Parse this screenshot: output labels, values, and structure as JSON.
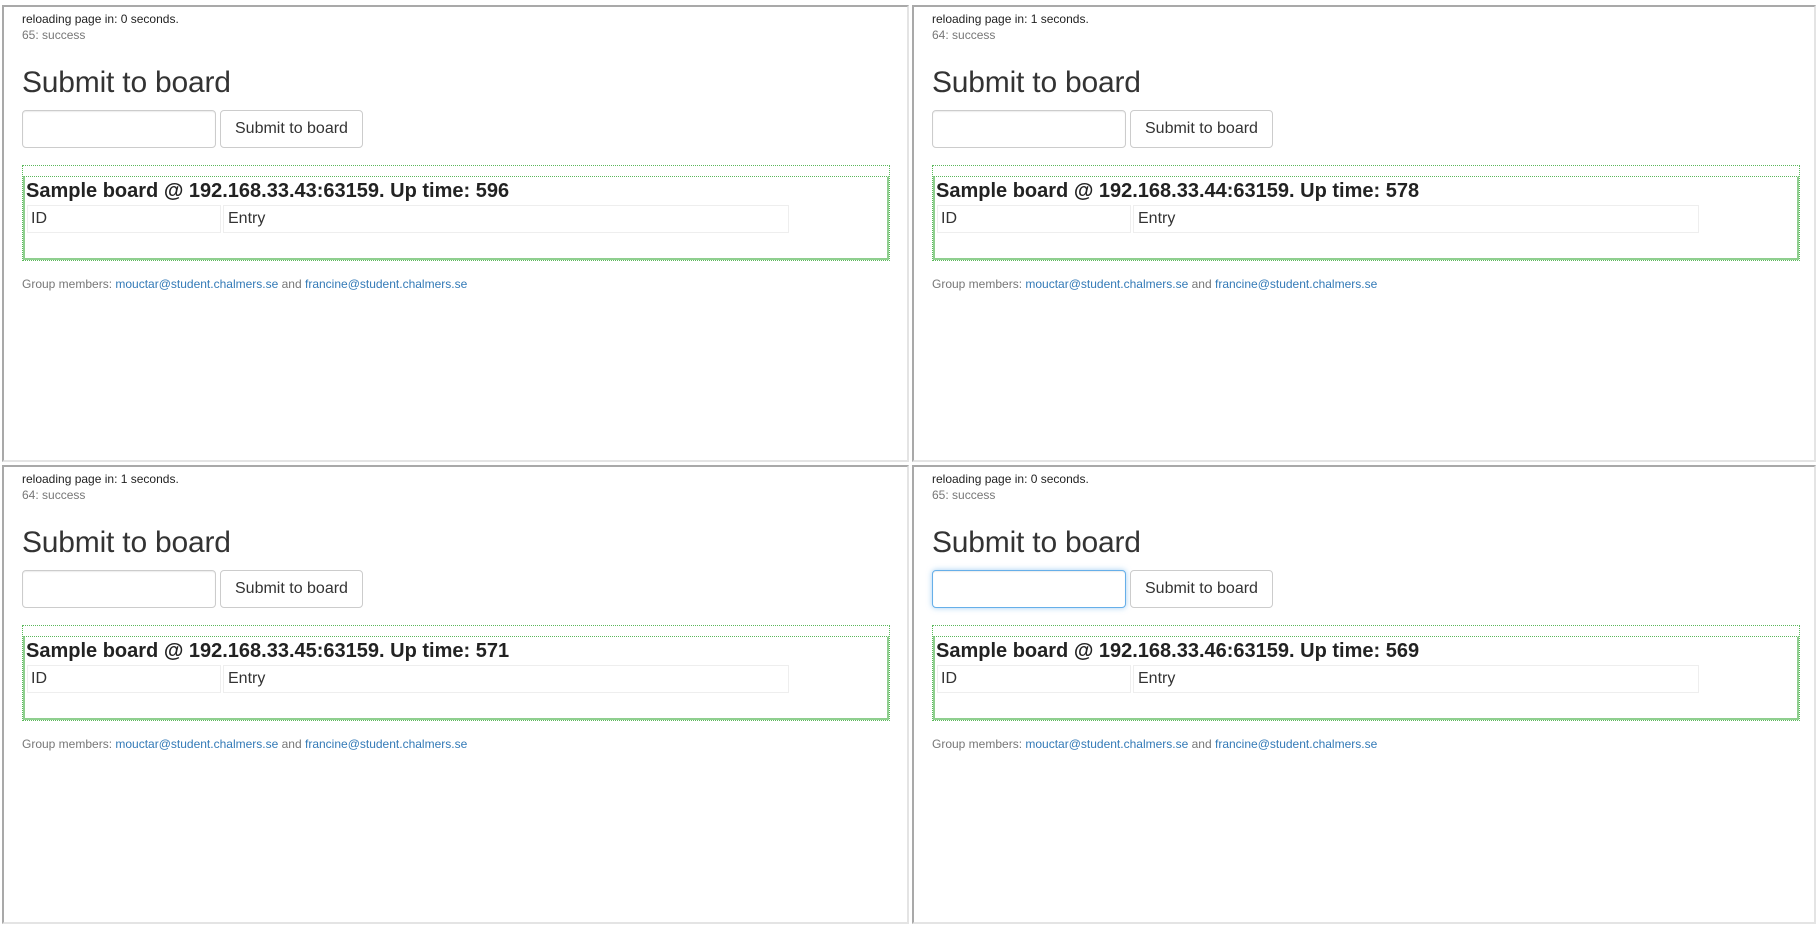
{
  "panes": [
    {
      "reload_text": "reloading page in: 0 seconds.",
      "status_text": "65: success",
      "heading": "Submit to board",
      "input_value": "",
      "button_label": "Submit to board",
      "board_title": "Sample board @ 192.168.33.43:63159. Up time: 596",
      "col_id": "ID",
      "col_entry": "Entry",
      "footer_prefix": "Group members: ",
      "member1": "mouctar@student.chalmers.se",
      "footer_and": " and ",
      "member2": "francine@student.chalmers.se"
    },
    {
      "reload_text": "reloading page in: 1 seconds.",
      "status_text": "64: success",
      "heading": "Submit to board",
      "input_value": "",
      "button_label": "Submit to board",
      "board_title": "Sample board @ 192.168.33.44:63159. Up time: 578",
      "col_id": "ID",
      "col_entry": "Entry",
      "footer_prefix": "Group members: ",
      "member1": "mouctar@student.chalmers.se",
      "footer_and": " and ",
      "member2": "francine@student.chalmers.se"
    },
    {
      "reload_text": "reloading page in: 1 seconds.",
      "status_text": "64: success",
      "heading": "Submit to board",
      "input_value": "",
      "button_label": "Submit to board",
      "board_title": "Sample board @ 192.168.33.45:63159. Up time: 571",
      "col_id": "ID",
      "col_entry": "Entry",
      "footer_prefix": "Group members: ",
      "member1": "mouctar@student.chalmers.se",
      "footer_and": " and ",
      "member2": "francine@student.chalmers.se"
    },
    {
      "reload_text": "reloading page in: 0 seconds.",
      "status_text": "65: success",
      "heading": "Submit to board",
      "input_value": "",
      "button_label": "Submit to board",
      "board_title": "Sample board @ 192.168.33.46:63159. Up time: 569",
      "col_id": "ID",
      "col_entry": "Entry",
      "footer_prefix": "Group members: ",
      "member1": "mouctar@student.chalmers.se",
      "footer_and": " and ",
      "member2": "francine@student.chalmers.se"
    }
  ],
  "colors": {
    "link": "#337ab7",
    "board_border": "#5cb85c",
    "focus_border": "#66afe9"
  }
}
